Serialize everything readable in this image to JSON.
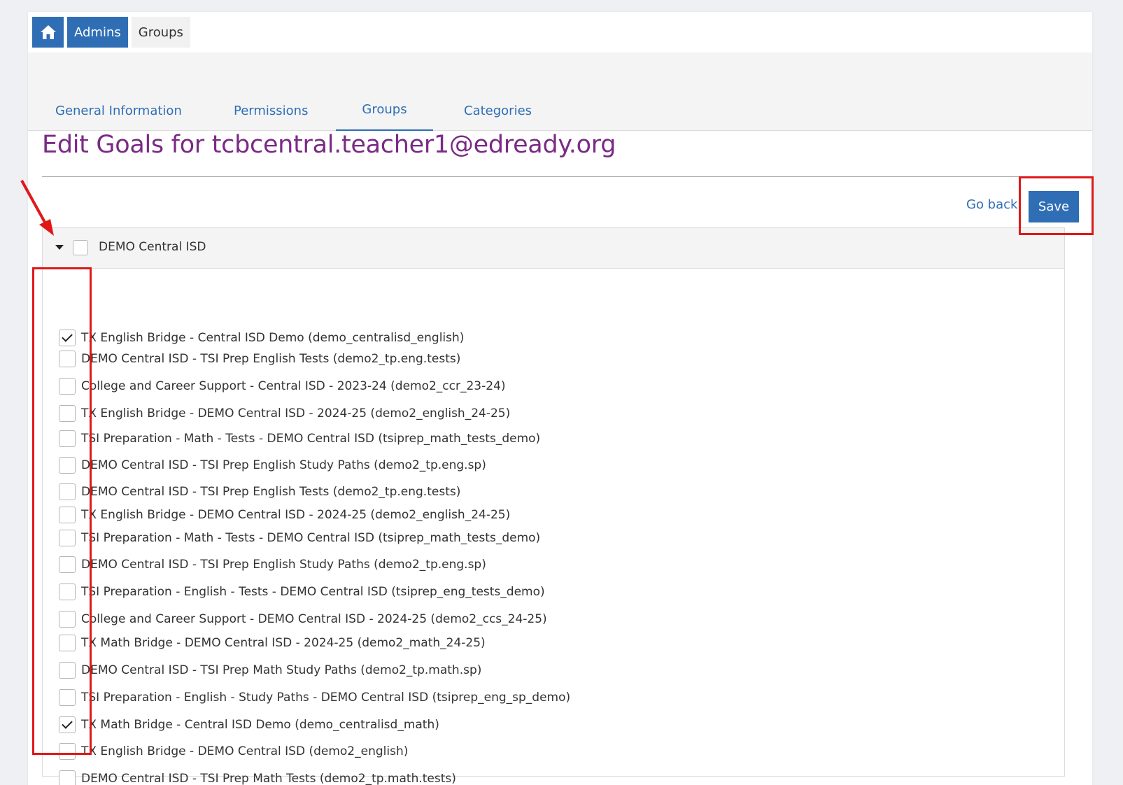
{
  "breadcrumb": {
    "home_icon": "home-icon",
    "admins": "Admins",
    "groups": "Groups"
  },
  "tabs": [
    {
      "label": "General Information",
      "active": false
    },
    {
      "label": "Permissions",
      "active": false
    },
    {
      "label": "Groups",
      "active": true
    },
    {
      "label": "Categories",
      "active": false
    }
  ],
  "page_title": "Edit Goals for tcbcentral.teacher1@edready.org",
  "actions": {
    "go_back": "Go back",
    "save": "Save"
  },
  "group": {
    "label": "DEMO Central ISD",
    "checked": false,
    "expanded": true
  },
  "goals": [
    {
      "label": "TX English Bridge - Central ISD Demo (demo_centralisd_english)",
      "checked": true
    },
    {
      "label": "DEMO Central ISD - TSI Prep English Tests (demo2_tp.eng.tests)",
      "checked": false
    },
    {
      "label": "College and Career Support - Central ISD - 2023-24 (demo2_ccr_23-24)",
      "checked": false
    },
    {
      "label": "TX English Bridge - DEMO Central ISD - 2024-25 (demo2_english_24-25)",
      "checked": false
    },
    {
      "label": "TSI Preparation - Math - Tests - DEMO Central ISD (tsiprep_math_tests_demo)",
      "checked": false
    },
    {
      "label": "DEMO Central ISD - TSI Prep English Study Paths (demo2_tp.eng.sp)",
      "checked": false
    },
    {
      "label": "DEMO Central ISD - TSI Prep English Tests (demo2_tp.eng.tests)",
      "checked": false
    },
    {
      "label": "TX English Bridge - DEMO Central ISD - 2024-25 (demo2_english_24-25)",
      "checked": false
    },
    {
      "label": "TSI Preparation - Math - Tests - DEMO Central ISD (tsiprep_math_tests_demo)",
      "checked": false
    },
    {
      "label": "DEMO Central ISD - TSI Prep English Study Paths (demo2_tp.eng.sp)",
      "checked": false
    },
    {
      "label": "TSI Preparation - English - Tests - DEMO Central ISD (tsiprep_eng_tests_demo)",
      "checked": false
    },
    {
      "label": "College and Career Support - DEMO Central ISD - 2024-25 (demo2_ccs_24-25)",
      "checked": false
    },
    {
      "label": "TX Math Bridge - DEMO Central ISD - 2024-25 (demo2_math_24-25)",
      "checked": false
    },
    {
      "label": "DEMO Central ISD - TSI Prep Math Study Paths (demo2_tp.math.sp)",
      "checked": false
    },
    {
      "label": "TSI Preparation - English - Study Paths - DEMO Central ISD (tsiprep_eng_sp_demo)",
      "checked": false
    },
    {
      "label": "TX Math Bridge - Central ISD Demo (demo_centralisd_math)",
      "checked": true
    },
    {
      "label": "TX English Bridge - DEMO Central ISD (demo2_english)",
      "checked": false
    },
    {
      "label": "DEMO Central ISD - TSI Prep Math Tests (demo2_tp.math.tests)",
      "checked": false
    }
  ],
  "colors": {
    "primary": "#2f6eb5",
    "title": "#7b2a86",
    "annotation": "#e01818"
  }
}
